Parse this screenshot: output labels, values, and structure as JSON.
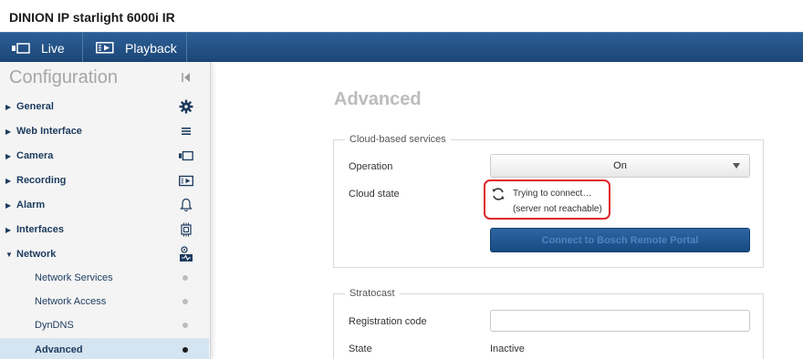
{
  "device": {
    "title": "DINION IP starlight 6000i IR"
  },
  "nav": {
    "live_label": "Live",
    "playback_label": "Playback",
    "bg_color": "#1c4677"
  },
  "sidebar": {
    "title": "Configuration",
    "items": [
      {
        "label": "General",
        "icon": "gear-icon"
      },
      {
        "label": "Web Interface",
        "icon": "menu-icon"
      },
      {
        "label": "Camera",
        "icon": "camera-icon"
      },
      {
        "label": "Recording",
        "icon": "recording-icon"
      },
      {
        "label": "Alarm",
        "icon": "bell-icon"
      },
      {
        "label": "Interfaces",
        "icon": "interfaces-icon"
      },
      {
        "label": "Network",
        "icon": "network-icon",
        "expanded": true
      }
    ],
    "subitems": [
      {
        "label": "Network Services"
      },
      {
        "label": "Network Access"
      },
      {
        "label": "DynDNS"
      },
      {
        "label": "Advanced",
        "active": true
      }
    ]
  },
  "main": {
    "heading": "Advanced",
    "cloud": {
      "legend": "Cloud-based services",
      "operation_label": "Operation",
      "operation_value": "On",
      "cloud_state_label": "Cloud state",
      "cloud_state_line1": "Trying to connect…",
      "cloud_state_line2": "(server not reachable)",
      "connect_button": "Connect to Bosch Remote Portal"
    },
    "stratocast": {
      "legend": "Stratocast",
      "registration_label": "Registration code",
      "registration_value": "",
      "state_label": "State",
      "state_value": "Inactive"
    }
  },
  "colors": {
    "accent": "#1c4677",
    "highlight": "#e0242c",
    "active_row": "#d5e4f1"
  }
}
